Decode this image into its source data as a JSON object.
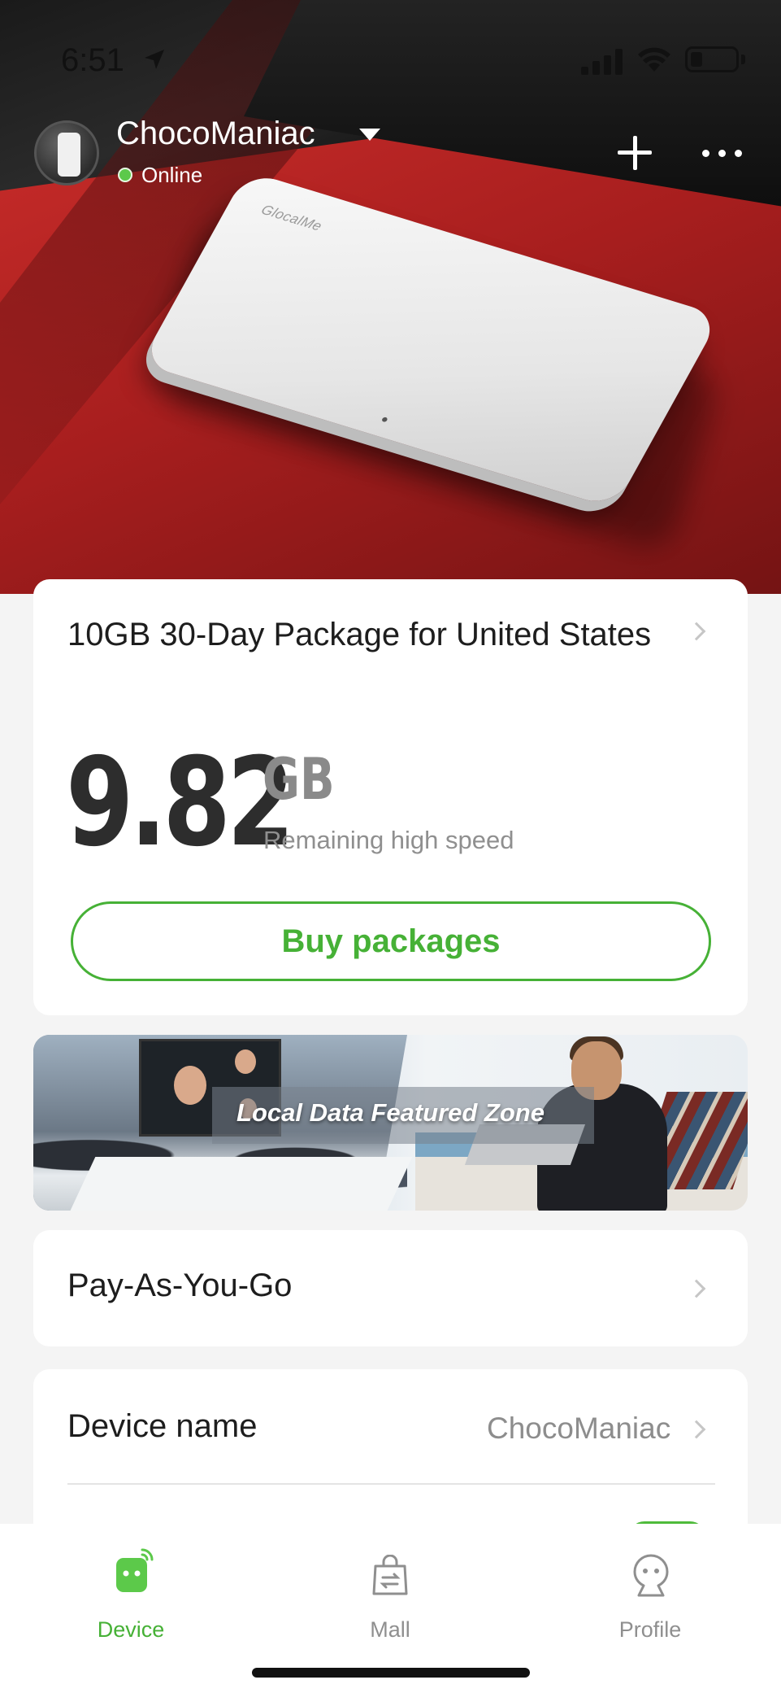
{
  "status_bar": {
    "time": "6:51"
  },
  "device": {
    "name": "ChocoManiac",
    "status": "Online",
    "brand_logo": "GlocalMe"
  },
  "package": {
    "name": "10GB 30-Day Package for United States",
    "remaining_value": "9.82",
    "remaining_unit": "GB",
    "remaining_label": "Remaining high speed",
    "buy_label": "Buy packages"
  },
  "banner": {
    "text": "Local Data Featured Zone"
  },
  "pay_as_you_go": {
    "label": "Pay-As-You-Go"
  },
  "settings": {
    "device_name_label": "Device name",
    "device_name_value": "ChocoManiac"
  },
  "tabs": [
    {
      "label": "Device",
      "icon": "device-icon",
      "active": true
    },
    {
      "label": "Mall",
      "icon": "shopping-bag-icon",
      "active": false
    },
    {
      "label": "Profile",
      "icon": "profile-icon",
      "active": false
    }
  ],
  "colors": {
    "accent_green": "#46b136",
    "online_green": "#5cc94a",
    "hero_red": "#c32a28"
  }
}
